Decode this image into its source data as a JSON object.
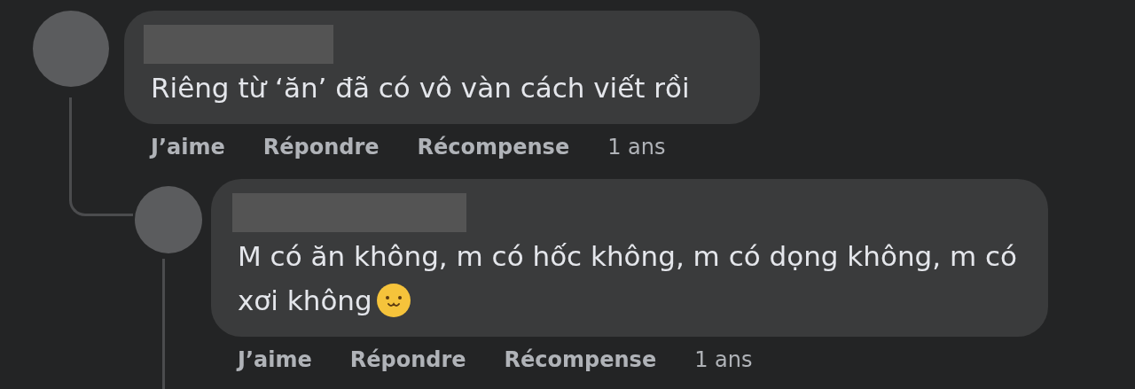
{
  "comments": [
    {
      "author": {
        "redacted": true
      },
      "text": "Riêng từ ‘ăn’ đã có vô vàn cách viết rồi",
      "emoji": false,
      "actions": [
        {
          "label": "J’aime",
          "kind": "action"
        },
        {
          "label": "Répondre",
          "kind": "action"
        },
        {
          "label": "Récompense",
          "kind": "action"
        },
        {
          "label": "1 ans",
          "kind": "time"
        }
      ],
      "replies": [
        {
          "author": {
            "redacted": true
          },
          "text": "M có ăn không, m có hốc không, m có dọng không, m có xơi không",
          "emoji": true,
          "actions": [
            {
              "label": "J’aime",
              "kind": "action"
            },
            {
              "label": "Répondre",
              "kind": "action"
            },
            {
              "label": "Récompense",
              "kind": "action"
            },
            {
              "label": "1 ans",
              "kind": "time"
            }
          ]
        }
      ]
    }
  ]
}
